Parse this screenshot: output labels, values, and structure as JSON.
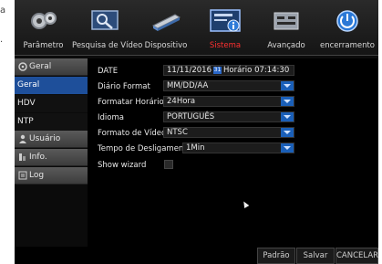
{
  "page_edge": {
    "line1": "a",
    "line2": "."
  },
  "toolbar": [
    {
      "label": "Parâmetro",
      "icon": "gears-icon"
    },
    {
      "label": "Pesquisa de Vídeo",
      "icon": "video-search-icon"
    },
    {
      "label": "Dispositivo",
      "icon": "hard-drive-icon"
    },
    {
      "label": "Sistema",
      "icon": "system-info-icon"
    },
    {
      "label": "Avançado",
      "icon": "advanced-settings-icon"
    },
    {
      "label": "encerramento",
      "icon": "power-icon"
    }
  ],
  "active_tab": "Sistema",
  "sidebar": {
    "geral_header": "Geral",
    "sub_items": [
      "Geral",
      "HDV",
      "NTP"
    ],
    "usuario": "Usuário",
    "info": "Info.",
    "log": "Log"
  },
  "settings": {
    "date_label": "DATE",
    "date_value": "11/11/2016",
    "time_label": "Horário",
    "time_value": "07:14:30",
    "diario_label": "Diário Format",
    "diario_value": "MM/DD/AA",
    "formatar_label": "Formatar Horário",
    "formatar_value": "24Hora",
    "idioma_label": "Idioma",
    "idioma_value": "PORTUGUÊS",
    "formato_label": "Formato de Vídeo",
    "formato_value": "NTSC",
    "tempo_label": "Tempo de Desligamento",
    "tempo_value": "1Min",
    "wizard_label": "Show wizard",
    "wizard_checked": false
  },
  "buttons": {
    "padrao": "Padrão",
    "salvar": "Salvar",
    "cancelar": "CANCELAR"
  },
  "colors": {
    "accent": "#1e4f9a",
    "active_label": "#ff3030",
    "background": "#000000"
  }
}
